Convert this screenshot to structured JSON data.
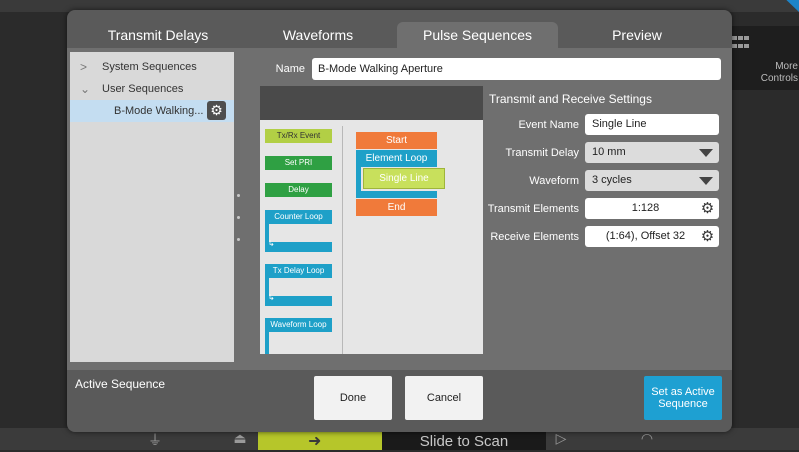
{
  "background": {
    "more_controls": "More\nControls",
    "slide_to_scan": "Slide to Scan"
  },
  "tabs": [
    {
      "label": "Transmit Delays",
      "active": false
    },
    {
      "label": "Waveforms",
      "active": false
    },
    {
      "label": "Pulse Sequences",
      "active": true
    },
    {
      "label": "Preview",
      "active": false
    }
  ],
  "tree": {
    "system": "System Sequences",
    "user": "User Sequences",
    "selected": "B-Mode Walking..."
  },
  "name": {
    "label": "Name",
    "value": "B-Mode Walking Aperture"
  },
  "palette": {
    "txrx": "Tx/Rx Event",
    "set_pri": "Set PRI",
    "delay": "Delay",
    "counter_loop": "Counter Loop",
    "tx_delay_loop": "Tx Delay Loop",
    "waveform_loop": "Waveform Loop"
  },
  "sequence": {
    "start": "Start",
    "element_loop": "Element Loop",
    "single_line": "Single Line",
    "end": "End"
  },
  "settings": {
    "title": "Transmit and Receive Settings",
    "event_name_label": "Event Name",
    "event_name": "Single Line",
    "transmit_delay_label": "Transmit Delay",
    "transmit_delay": "10 mm",
    "waveform_label": "Waveform",
    "waveform": "3 cycles",
    "transmit_elements_label": "Transmit Elements",
    "transmit_elements": "1:128",
    "receive_elements_label": "Receive Elements",
    "receive_elements": "(1:64), Offset 32"
  },
  "footer": {
    "active_sequence": "Active Sequence",
    "done": "Done",
    "cancel": "Cancel",
    "set_active_line1": "Set as Active",
    "set_active_line2": "Sequence"
  }
}
